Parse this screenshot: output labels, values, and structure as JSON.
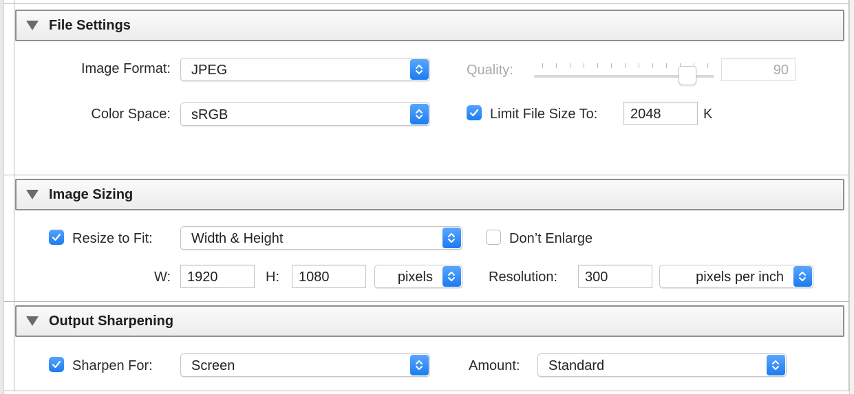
{
  "file_settings": {
    "title": "File Settings",
    "image_format_label": "Image Format:",
    "image_format_value": "JPEG",
    "color_space_label": "Color Space:",
    "color_space_value": "sRGB",
    "quality_label": "Quality:",
    "quality_value": "90",
    "quality_enabled": false,
    "limit_file_size_checked": true,
    "limit_file_size_label": "Limit File Size To:",
    "limit_file_size_value": "2048",
    "limit_file_size_unit": "K"
  },
  "image_sizing": {
    "title": "Image Sizing",
    "resize_checked": true,
    "resize_label": "Resize to Fit:",
    "resize_value": "Width & Height",
    "dont_enlarge_checked": false,
    "dont_enlarge_label": "Don’t Enlarge",
    "w_label": "W:",
    "w_value": "1920",
    "h_label": "H:",
    "h_value": "1080",
    "units_value": "pixels",
    "resolution_label": "Resolution:",
    "resolution_value": "300",
    "resolution_units_value": "pixels per inch"
  },
  "output_sharpening": {
    "title": "Output Sharpening",
    "sharpen_checked": true,
    "sharpen_label": "Sharpen For:",
    "sharpen_value": "Screen",
    "amount_label": "Amount:",
    "amount_value": "Standard"
  },
  "colors": {
    "accent": "#1b7cf0",
    "header_border": "#8f8f8f",
    "disabled_text": "#aaaaaa"
  },
  "icons": {
    "section_toggle": "disclosure-triangle-icon",
    "popup_stepper": "up-down-chevron-icon",
    "check": "checkmark-icon"
  }
}
